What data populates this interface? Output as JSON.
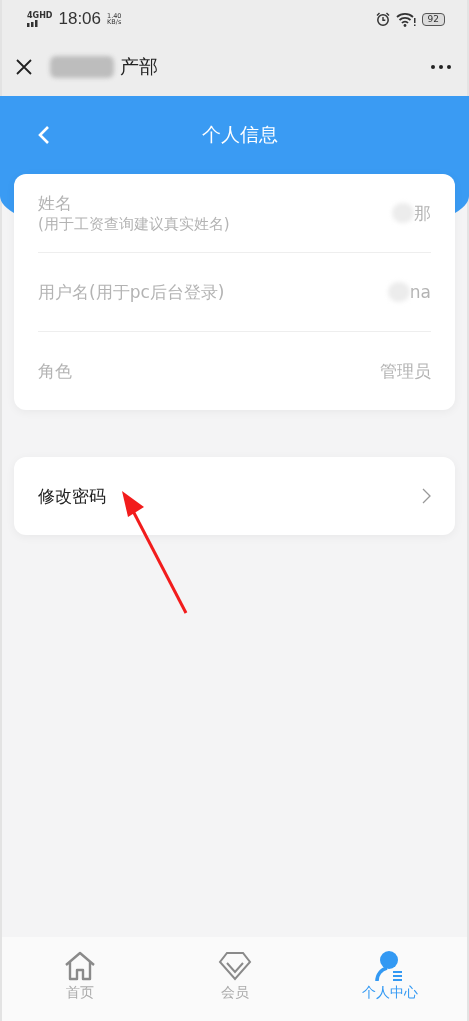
{
  "status_bar": {
    "network": "4GHD",
    "time": "18:06",
    "speed": "1.40",
    "speed_unit": "KB/s",
    "battery": "92"
  },
  "title_bar": {
    "title": "产部"
  },
  "header": {
    "title": "个人信息"
  },
  "info_rows": [
    {
      "label": "姓名",
      "hint": "(用于工资查询建议真实姓名)",
      "value": "那"
    },
    {
      "label": "用户名(用于pc后台登录)",
      "value": "na"
    },
    {
      "label": "角色",
      "value": "管理员"
    }
  ],
  "actions": [
    {
      "label": "修改密码"
    }
  ],
  "tab_bar": [
    {
      "label": "首页",
      "kind": "home",
      "selected": false
    },
    {
      "label": "会员",
      "kind": "diamond",
      "selected": false
    },
    {
      "label": "个人中心",
      "kind": "person",
      "selected": true
    }
  ]
}
